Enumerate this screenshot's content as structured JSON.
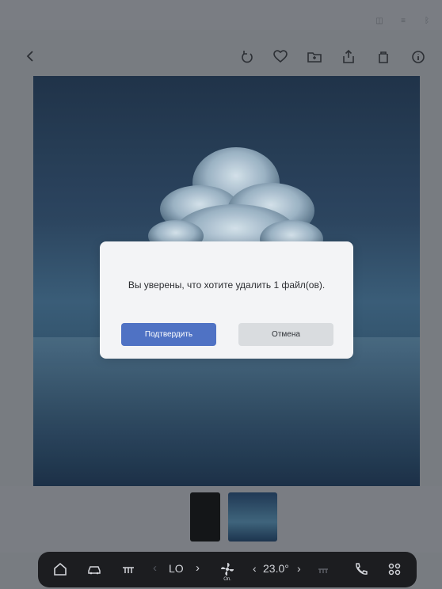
{
  "statusBar": {
    "icons": [
      "profile-icon",
      "signal-icon",
      "bluetooth-icon"
    ]
  },
  "toolbar": {
    "backIcon": "chevron-left-icon",
    "tools": [
      "rotate-icon",
      "heart-icon",
      "folder-icon",
      "share-icon",
      "trash-icon",
      "info-icon"
    ]
  },
  "dialog": {
    "message": "Вы уверены, что хотите удалить 1 файл(ов).",
    "confirm": "Подтвердить",
    "cancel": "Отмена"
  },
  "dock": {
    "fanLeft": "LO",
    "temperature": "23.0°",
    "fanCaption": "Оп."
  },
  "colors": {
    "accent": "#4f72c4",
    "dock": "#1c1d20",
    "dialogBg": "#f3f4f6"
  }
}
